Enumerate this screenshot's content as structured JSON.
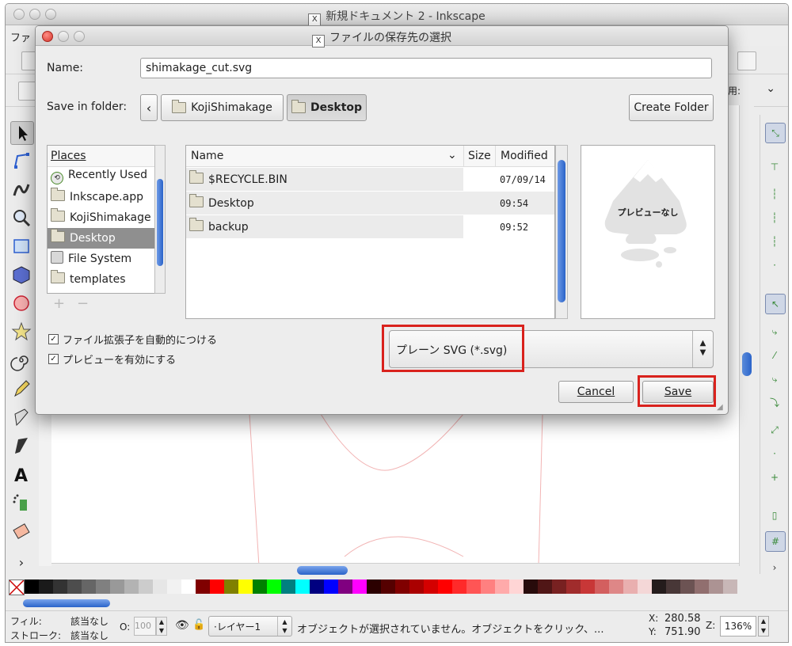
{
  "main_window": {
    "title": "新規ドキュメント 2 - Inkscape",
    "menu_first": "ファ",
    "controls_right_text": "a用:",
    "title_icon": "X"
  },
  "dialog": {
    "title": "ファイルの保存先の選択",
    "title_icon": "X",
    "name_label": "Name:",
    "name_value": "shimakage_cut.svg",
    "save_in_label": "Save in folder:",
    "path_back": "‹",
    "path_items": [
      "KojiShimakage",
      "Desktop"
    ],
    "create_folder_label": "Create Folder",
    "places_header": "Places",
    "places": [
      {
        "label": "Recently Used",
        "icon": "recent-icon"
      },
      {
        "label": "Inkscape.app",
        "icon": "folder-icon"
      },
      {
        "label": "KojiShimakage",
        "icon": "folder-icon"
      },
      {
        "label": "Desktop",
        "icon": "folder-icon",
        "selected": true
      },
      {
        "label": "File System",
        "icon": "drive-icon"
      },
      {
        "label": "templates",
        "icon": "folder-icon"
      }
    ],
    "places_add": "+",
    "places_remove": "−",
    "columns": {
      "name": "Name",
      "size": "Size",
      "modified": "Modified"
    },
    "files": [
      {
        "name": "$RECYCLE.BIN",
        "size": "",
        "modified": "07/09/14"
      },
      {
        "name": "Desktop",
        "size": "",
        "modified": "09:54"
      },
      {
        "name": "backup",
        "size": "",
        "modified": "09:52"
      }
    ],
    "preview_text": "プレビューなし",
    "checkbox_extension": "ファイル拡張子を自動的につける",
    "checkbox_preview": "プレビューを有効にする",
    "filter_value": "プレーン SVG (*.svg)",
    "cancel_label": "Cancel",
    "save_label": "Save",
    "highlight_color": "#d9221d"
  },
  "statusbar": {
    "fill_label": "フィル:",
    "fill_value": "該当なし",
    "stroke_label": "ストローク:",
    "stroke_value": "該当なし",
    "opacity_label": "O:",
    "opacity_value": "100",
    "layer": "·レイヤー1",
    "message": "オブジェクトが選択されていません。オブジェクトをクリック、...",
    "x_label": "X:",
    "x_value": "280.58",
    "y_label": "Y:",
    "y_value": "751.90",
    "zoom_label": "Z:",
    "zoom_value": "136%"
  },
  "palette_colors": [
    "#000000",
    "#1a1a1a",
    "#333333",
    "#4d4d4d",
    "#666666",
    "#808080",
    "#999999",
    "#b3b3b3",
    "#cccccc",
    "#e6e6e6",
    "#f2f2f2",
    "#ffffff",
    "#800000",
    "#ff0000",
    "#808000",
    "#ffff00",
    "#008000",
    "#00ff00",
    "#008080",
    "#00ffff",
    "#000080",
    "#0000ff",
    "#800080",
    "#ff00ff",
    "#2b0000",
    "#550000",
    "#800000",
    "#aa0000",
    "#d40000",
    "#ff0000",
    "#ff2a2a",
    "#ff5555",
    "#ff8080",
    "#ffaaaa",
    "#ffd5d5",
    "#280b0b",
    "#501616",
    "#782121",
    "#a02c2c",
    "#c83737",
    "#d35f5f",
    "#de8787",
    "#e9afaf",
    "#f4d7d7",
    "#241c1c",
    "#483737",
    "#6c5353",
    "#916f6f",
    "#ac9393",
    "#c8b7b7"
  ]
}
